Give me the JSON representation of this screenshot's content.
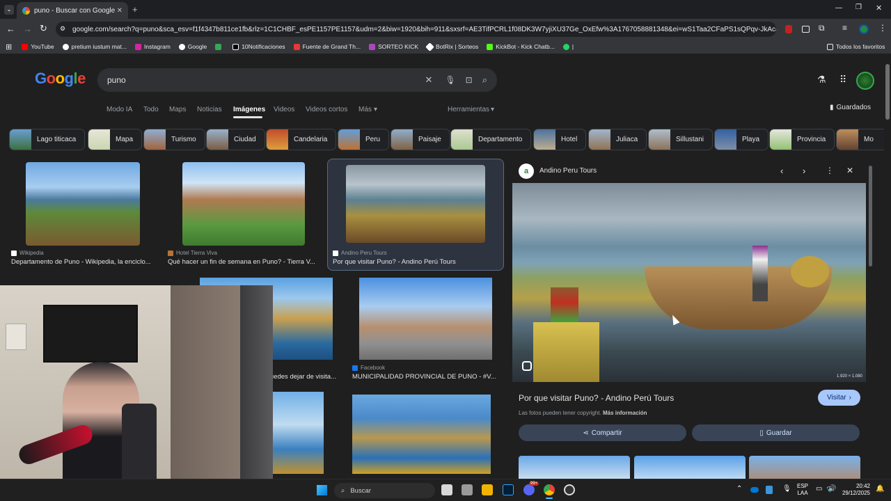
{
  "browser": {
    "tab_title": "puno - Buscar con Google",
    "url": "google.com/search?q=puno&sca_esv=f1f4347b811ce1fb&rlz=1C1CHBF_esPE1157PE1157&udm=2&biw=1920&bih=911&sxsrf=AE3TifPCRL1f08DK3W7yjiXU37Ge_OxEfw%3A1767058881348&ei=wS1Taa2CFaPS1sQPqv-JkAc&ved=0ahUK...",
    "bookmarks": [
      "YouTube",
      "pretium iustum mat...",
      "Instagram",
      "Google",
      "10Notificaciones",
      "Fuente de Grand Th...",
      "SORTEO KICK",
      "BotRix | Sorteos",
      "KickBot - Kick Chatb...",
      "|"
    ],
    "all_favorites": "Todos los favoritos"
  },
  "google": {
    "logo": "Google",
    "query": "puno",
    "nav": [
      "Modo IA",
      "Todo",
      "Maps",
      "Noticias",
      "Imágenes",
      "Videos",
      "Videos cortos",
      "Más"
    ],
    "tools": "Herramientas",
    "saved": "Guardados",
    "chips": [
      "Lago titicaca",
      "Mapa",
      "Turismo",
      "Ciudad",
      "Candelaria",
      "Peru",
      "Paisaje",
      "Departamento",
      "Hotel",
      "Juliaca",
      "Sillustani",
      "Playa",
      "Provincia",
      "Mo"
    ]
  },
  "results": [
    {
      "source": "Wikipedia",
      "title": "Departamento de Puno - Wikipedia, la enciclo..."
    },
    {
      "source": "Hotel Tierra Viva",
      "title": "Qué hacer un fin de semana en Puno? - Tierra V..."
    },
    {
      "source": "Andino Peru Tours",
      "title": "Por que visitar Puno? - Andino Perú Tours"
    },
    {
      "source": "",
      "title": "...uedes dejar de visita..."
    },
    {
      "source": "Facebook",
      "title": "MUNICIPALIDAD PROVINCIAL DE PUNO - #V..."
    }
  ],
  "preview": {
    "site": "Andino Peru Tours",
    "dimensions": "1.920 × 1.080",
    "title": "Por que visitar Puno? - Andino Perú Tours",
    "visit": "Visitar",
    "copyright": "Las fotos pueden tener copyright.",
    "more_info": "Más información",
    "share": "Compartir",
    "save": "Guardar"
  },
  "taskbar": {
    "search": "Buscar",
    "lang1": "ESP",
    "lang2": "LAA",
    "time": "20:42",
    "date": "29/12/2025",
    "badge": "99+"
  }
}
